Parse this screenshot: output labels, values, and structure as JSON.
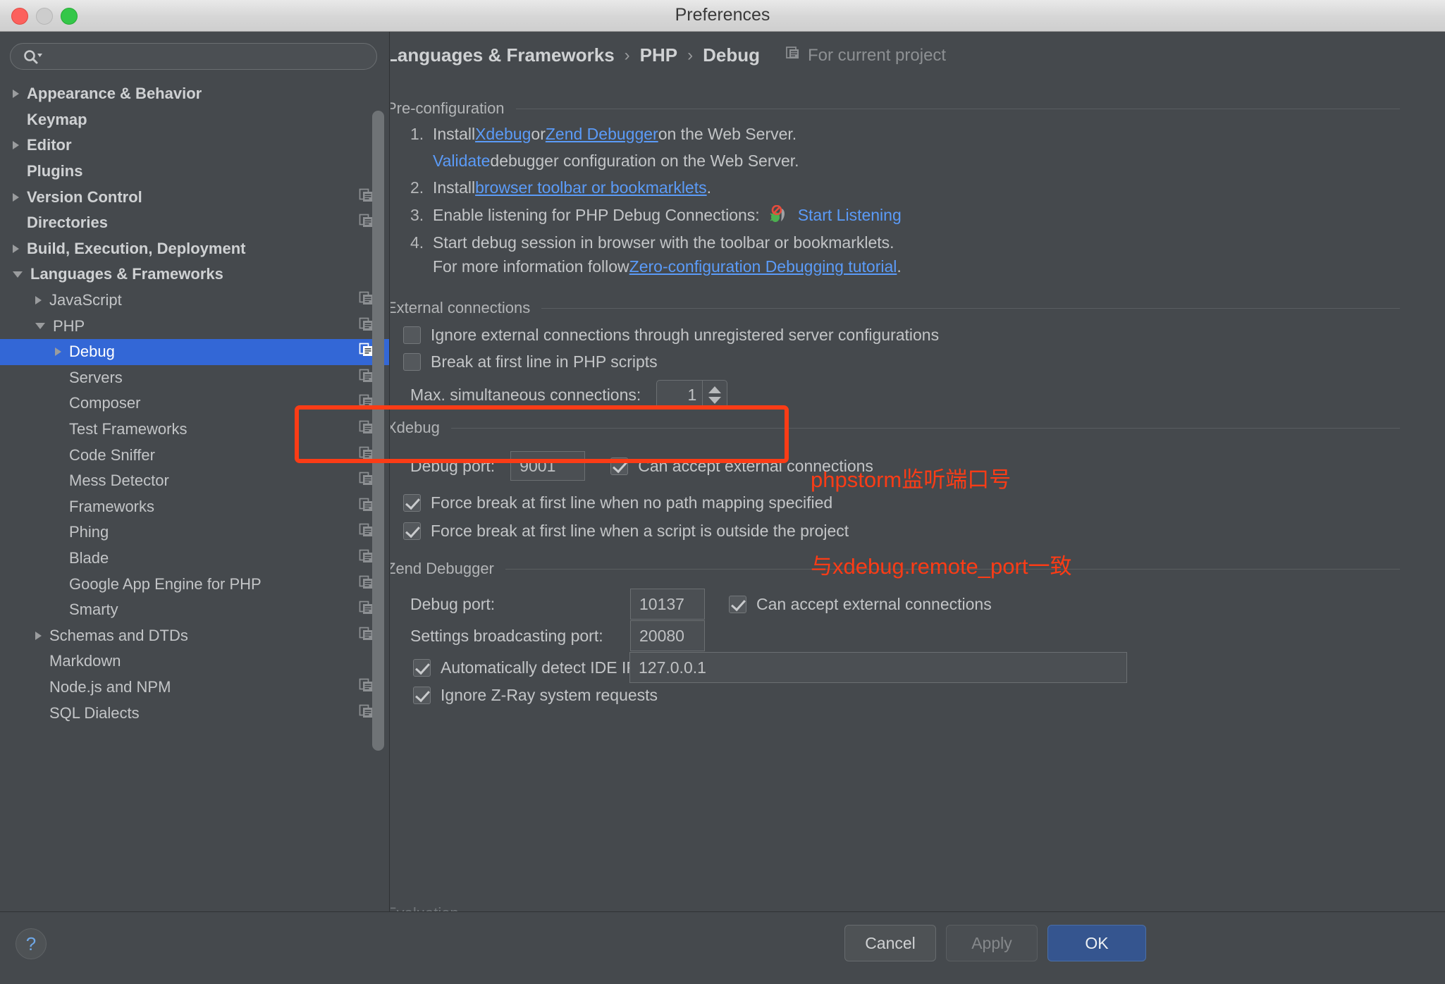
{
  "window": {
    "title": "Preferences",
    "traffic_lights": [
      "close",
      "minimize",
      "zoom"
    ]
  },
  "sidebar": {
    "search": {
      "placeholder": "",
      "value": "",
      "icon": "search-icon"
    },
    "items": [
      {
        "label": "Appearance & Behavior",
        "indent": 0,
        "arrow": "right",
        "bold": true,
        "copy": false,
        "selected": false
      },
      {
        "label": "Keymap",
        "indent": 0,
        "arrow": "none",
        "bold": true,
        "copy": false,
        "selected": false
      },
      {
        "label": "Editor",
        "indent": 0,
        "arrow": "right",
        "bold": true,
        "copy": false,
        "selected": false
      },
      {
        "label": "Plugins",
        "indent": 0,
        "arrow": "none",
        "bold": true,
        "copy": false,
        "selected": false
      },
      {
        "label": "Version Control",
        "indent": 0,
        "arrow": "right",
        "bold": true,
        "copy": true,
        "selected": false
      },
      {
        "label": "Directories",
        "indent": 0,
        "arrow": "none",
        "bold": true,
        "copy": true,
        "selected": false
      },
      {
        "label": "Build, Execution, Deployment",
        "indent": 0,
        "arrow": "right",
        "bold": true,
        "copy": false,
        "selected": false
      },
      {
        "label": "Languages & Frameworks",
        "indent": 0,
        "arrow": "down",
        "bold": true,
        "copy": false,
        "selected": false
      },
      {
        "label": "JavaScript",
        "indent": 1,
        "arrow": "right",
        "bold": false,
        "copy": true,
        "selected": false
      },
      {
        "label": "PHP",
        "indent": 1,
        "arrow": "down",
        "bold": false,
        "copy": true,
        "selected": false
      },
      {
        "label": "Debug",
        "indent": 2,
        "arrow": "right",
        "bold": false,
        "copy": true,
        "selected": true
      },
      {
        "label": "Servers",
        "indent": 2,
        "arrow": "none",
        "bold": false,
        "copy": true,
        "selected": false
      },
      {
        "label": "Composer",
        "indent": 2,
        "arrow": "none",
        "bold": false,
        "copy": true,
        "selected": false
      },
      {
        "label": "Test Frameworks",
        "indent": 2,
        "arrow": "none",
        "bold": false,
        "copy": true,
        "selected": false
      },
      {
        "label": "Code Sniffer",
        "indent": 2,
        "arrow": "none",
        "bold": false,
        "copy": true,
        "selected": false
      },
      {
        "label": "Mess Detector",
        "indent": 2,
        "arrow": "none",
        "bold": false,
        "copy": true,
        "selected": false
      },
      {
        "label": "Frameworks",
        "indent": 2,
        "arrow": "none",
        "bold": false,
        "copy": true,
        "selected": false
      },
      {
        "label": "Phing",
        "indent": 2,
        "arrow": "none",
        "bold": false,
        "copy": true,
        "selected": false
      },
      {
        "label": "Blade",
        "indent": 2,
        "arrow": "none",
        "bold": false,
        "copy": true,
        "selected": false
      },
      {
        "label": "Google App Engine for PHP",
        "indent": 2,
        "arrow": "none",
        "bold": false,
        "copy": true,
        "selected": false
      },
      {
        "label": "Smarty",
        "indent": 2,
        "arrow": "none",
        "bold": false,
        "copy": true,
        "selected": false
      },
      {
        "label": "Schemas and DTDs",
        "indent": 1,
        "arrow": "right",
        "bold": false,
        "copy": true,
        "selected": false
      },
      {
        "label": "Markdown",
        "indent": 1,
        "arrow": "none",
        "bold": false,
        "copy": false,
        "selected": false
      },
      {
        "label": "Node.js and NPM",
        "indent": 1,
        "arrow": "none",
        "bold": false,
        "copy": true,
        "selected": false
      },
      {
        "label": "SQL Dialects",
        "indent": 1,
        "arrow": "none",
        "bold": false,
        "copy": true,
        "selected": false
      }
    ]
  },
  "breadcrumb": {
    "crumb1": "Languages & Frameworks",
    "sep1": "›",
    "crumb2": "PHP",
    "sep2": "›",
    "crumb3": "Debug",
    "scope_label": "For current project",
    "scope_icon": "project-scope-icon"
  },
  "preconfiguration": {
    "title": "Pre-configuration",
    "step1": {
      "number": "1.",
      "pre": "Install ",
      "link1": "Xdebug",
      "mid": " or ",
      "link2": "Zend Debugger",
      "post": " on the Web Server."
    },
    "validate": {
      "link": "Validate",
      "text": " debugger configuration on the Web Server."
    },
    "step2": {
      "number": "2.",
      "pre": "Install ",
      "link": "browser toolbar or bookmarklets",
      "post": "."
    },
    "step3": {
      "number": "3.",
      "text": "Enable listening for PHP Debug Connections:",
      "icon": "listen-phone-bug-icon",
      "link": "Start Listening"
    },
    "step4": {
      "number": "4.",
      "text": "Start debug session in browser with the toolbar or bookmarklets."
    },
    "more_info": {
      "pre": "For more information follow ",
      "link": "Zero-configuration Debugging tutorial",
      "post": "."
    }
  },
  "external_connections": {
    "title": "External connections",
    "ignore_unregistered": {
      "label": "Ignore external connections through unregistered server configurations",
      "checked": false
    },
    "break_first_line": {
      "label": "Break at first line in PHP scripts",
      "checked": false
    },
    "max_connections": {
      "label": "Max. simultaneous connections:",
      "value": "1"
    }
  },
  "xdebug": {
    "title": "Xdebug",
    "debug_port": {
      "label": "Debug port:",
      "value": "9001"
    },
    "can_accept": {
      "label": "Can accept external connections",
      "checked": true
    },
    "force_break_no_mapping": {
      "label": "Force break at first line when no path mapping specified",
      "checked": true
    },
    "force_break_outside": {
      "label": "Force break at first line when a script is outside the project",
      "checked": true
    }
  },
  "zend_debugger": {
    "title": "Zend Debugger",
    "debug_port": {
      "label": "Debug port:",
      "value": "10137"
    },
    "can_accept": {
      "label": "Can accept external connections",
      "checked": true
    },
    "broadcast_port": {
      "label": "Settings broadcasting port:",
      "value": "20080"
    },
    "auto_detect_ip": {
      "label": "Automatically detect IDE IP:",
      "checked": true,
      "value": "127.0.0.1"
    },
    "ignore_zray": {
      "label": "Ignore Z-Ray system requests",
      "checked": true
    }
  },
  "evaluation": {
    "title": "Evaluation"
  },
  "annotation": {
    "color": "#fb3c16",
    "line1": "phpstorm监听端口号",
    "line2": "与xdebug.remote_port一致"
  },
  "footer": {
    "help": "?",
    "cancel": "Cancel",
    "apply": "Apply",
    "ok": "OK"
  }
}
